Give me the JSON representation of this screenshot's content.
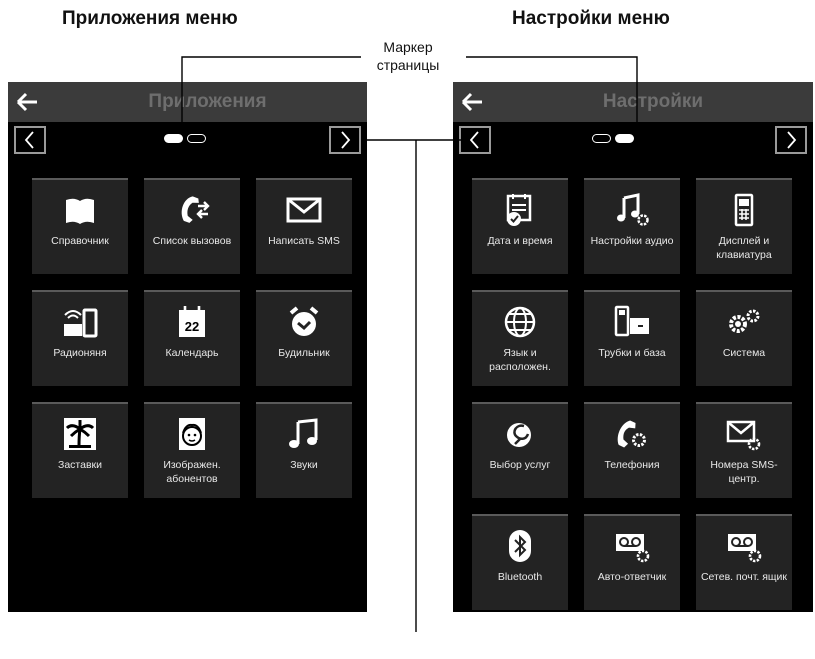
{
  "captions": {
    "left": "Приложения меню",
    "right": "Настройки меню",
    "page_marker_line1": "Маркер",
    "page_marker_line2": "страницы"
  },
  "screens": [
    {
      "title": "Приложения",
      "page_indicator": {
        "pages": 2,
        "current": 1
      },
      "tiles": [
        {
          "label": "Справочник",
          "icon": "book-icon"
        },
        {
          "label": "Список вызовов",
          "icon": "call-list-icon"
        },
        {
          "label": "Написать SMS",
          "icon": "envelope-icon"
        },
        {
          "label": "Радионяня",
          "icon": "baby-monitor-icon"
        },
        {
          "label": "Календарь",
          "icon": "calendar-icon",
          "icon_text": "22"
        },
        {
          "label": "Будильник",
          "icon": "alarm-clock-icon"
        },
        {
          "label": "Заставки",
          "icon": "palm-tree-icon"
        },
        {
          "label": "Изображен. абонентов",
          "icon": "caller-picture-icon"
        },
        {
          "label": "Звуки",
          "icon": "music-note-icon"
        }
      ]
    },
    {
      "title": "Настройки",
      "page_indicator": {
        "pages": 2,
        "current": 2
      },
      "tiles": [
        {
          "label": "Дата и время",
          "icon": "date-time-icon"
        },
        {
          "label": "Настройки аудио",
          "icon": "audio-settings-icon"
        },
        {
          "label": "Дисплей и клавиатура",
          "icon": "display-keypad-icon"
        },
        {
          "label": "Язык и расположен.",
          "icon": "globe-icon"
        },
        {
          "label": "Трубки и база",
          "icon": "handset-base-icon"
        },
        {
          "label": "Система",
          "icon": "gears-icon"
        },
        {
          "label": "Выбор услуг",
          "icon": "services-icon"
        },
        {
          "label": "Телефония",
          "icon": "telephony-icon"
        },
        {
          "label": "Номера SMS-центр.",
          "icon": "sms-centre-icon"
        },
        {
          "label": "Bluetooth",
          "icon": "bluetooth-icon"
        },
        {
          "label": "Авто-ответчик",
          "icon": "answering-machine-icon"
        },
        {
          "label": "Сетев. почт. ящик",
          "icon": "network-mailbox-icon"
        }
      ]
    }
  ]
}
